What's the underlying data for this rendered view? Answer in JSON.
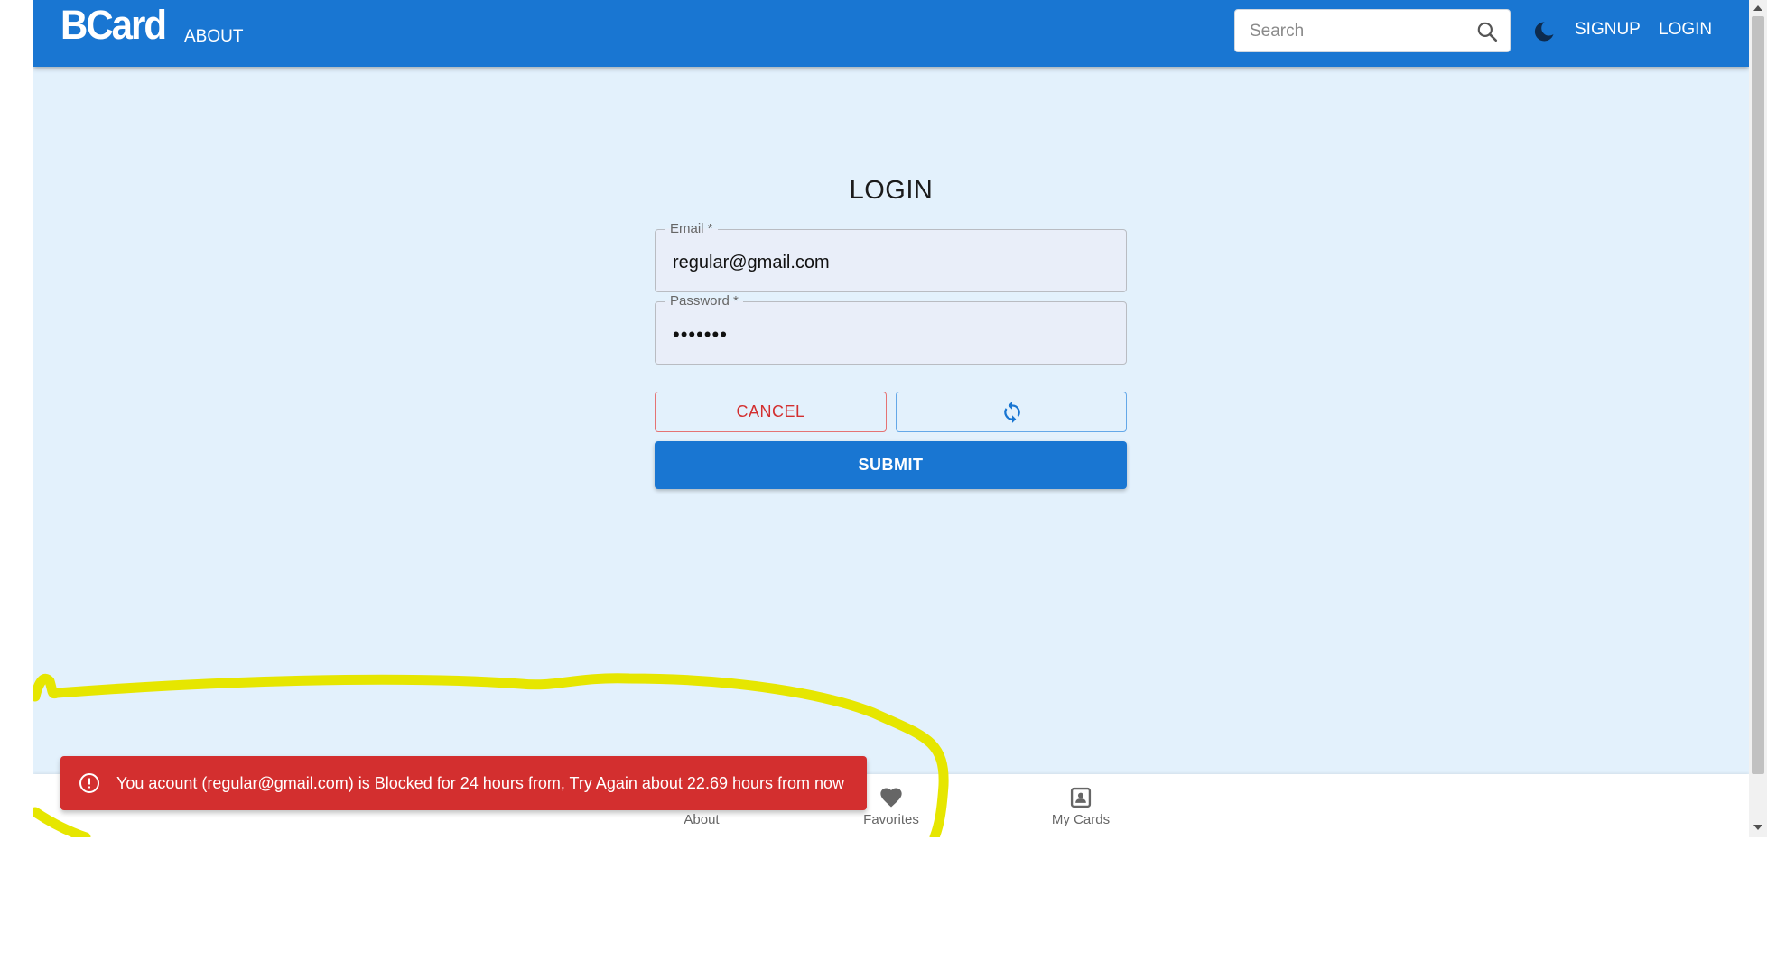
{
  "header": {
    "logo": "BCard",
    "about_label": "ABOUT",
    "search_placeholder": "Search",
    "signup_label": "SIGNUP",
    "login_label": "LOGIN"
  },
  "login_form": {
    "title": "LOGIN",
    "email_label": "Email *",
    "email_value": "regular@gmail.com",
    "password_label": "Password *",
    "password_value": "•••••••",
    "cancel_label": "CANCEL",
    "submit_label": "SUBMIT"
  },
  "bottom_nav": {
    "items": [
      {
        "label": "About",
        "icon": "info-icon"
      },
      {
        "label": "Favorites",
        "icon": "heart-icon"
      },
      {
        "label": "My Cards",
        "icon": "contact-card-icon"
      }
    ]
  },
  "snackbar": {
    "message": "You acount (regular@gmail.com) is Blocked for 24 hours from, Try Again about 22.69 hours from now",
    "icon": "error-outline-icon"
  },
  "colors": {
    "primary": "#1976d2",
    "background": "#e3f1fc",
    "error": "#d32f2f",
    "highlight": "#e6e600"
  }
}
